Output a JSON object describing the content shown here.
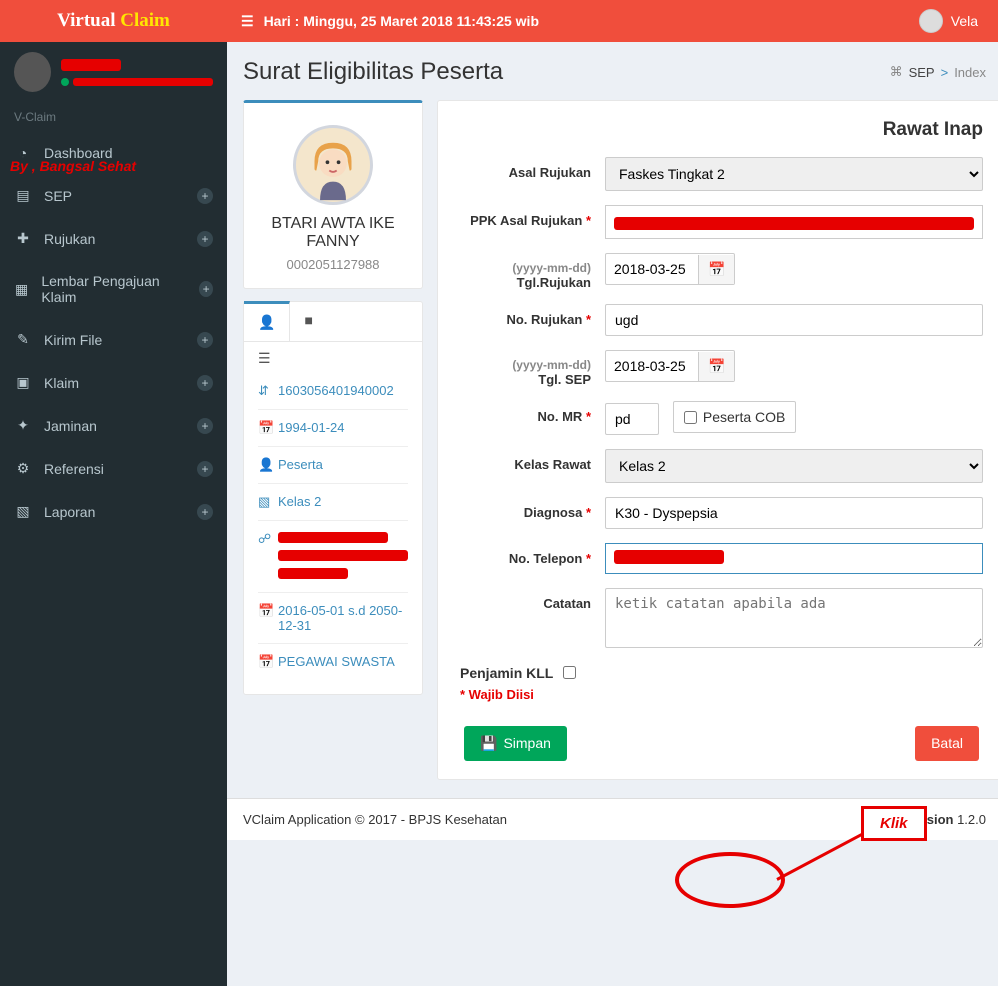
{
  "brand": {
    "p1": "Virtual",
    "p2": "Claim"
  },
  "header": {
    "date_line": "Hari : Minggu, 25 Maret 2018 11:43:25 wib",
    "user": "Vela"
  },
  "sidebar": {
    "small_label": "V-Claim",
    "overlay": "By , Bangsal Sehat",
    "menu": [
      {
        "label": "Dashboard",
        "expandable": false
      },
      {
        "label": "SEP",
        "expandable": true
      },
      {
        "label": "Rujukan",
        "expandable": true
      },
      {
        "label": "Lembar Pengajuan Klaim",
        "expandable": true
      },
      {
        "label": "Kirim File",
        "expandable": true
      },
      {
        "label": "Klaim",
        "expandable": true
      },
      {
        "label": "Jaminan",
        "expandable": true
      },
      {
        "label": "Referensi",
        "expandable": true
      },
      {
        "label": "Laporan",
        "expandable": true
      }
    ]
  },
  "page": {
    "title": "Surat Eligibilitas Peserta",
    "crumb1": "SEP",
    "crumb2": "Index"
  },
  "patient": {
    "name": "BTARI AWTA IKE FANNY",
    "id": "0002051127988",
    "details": {
      "nik": "1603056401940002",
      "dob": "1994-01-24",
      "status": "Peserta",
      "kelas": "Kelas 2",
      "period": "2016-05-01 s.d 2050-12-31",
      "occupation": "PEGAWAI SWASTA"
    }
  },
  "form": {
    "title": "Rawat Inap",
    "labels": {
      "asal_rujukan": "Asal Rujukan",
      "ppk_asal": "PPK Asal Rujukan",
      "tgl_rujukan": "Tgl.Rujukan",
      "no_rujukan": "No. Rujukan",
      "tgl_sep": "Tgl. SEP",
      "no_mr": "No. MR",
      "peserta_cob": "Peserta COB",
      "kelas_rawat": "Kelas Rawat",
      "diagnosa": "Diagnosa",
      "no_telepon": "No. Telepon",
      "catatan": "Catatan",
      "penjamin": "Penjamin KLL",
      "wajib": "* Wajib Diisi",
      "date_hint": "(yyyy-mm-dd)"
    },
    "values": {
      "asal_rujukan": "Faskes Tingkat 2",
      "tgl_rujukan": "2018-03-25",
      "no_rujukan": "ugd",
      "tgl_sep": "2018-03-25",
      "no_mr": "pd",
      "kelas_rawat": "Kelas 2",
      "diagnosa": "K30 - Dyspepsia",
      "catatan_placeholder": "ketik catatan apabila ada"
    },
    "buttons": {
      "simpan": "Simpan",
      "batal": "Batal"
    }
  },
  "footer": {
    "left": "VClaim Application © 2017 - BPJS Kesehatan",
    "ver_label": "Version",
    "ver": "1.2.0"
  },
  "anno": {
    "klik": "Klik"
  }
}
